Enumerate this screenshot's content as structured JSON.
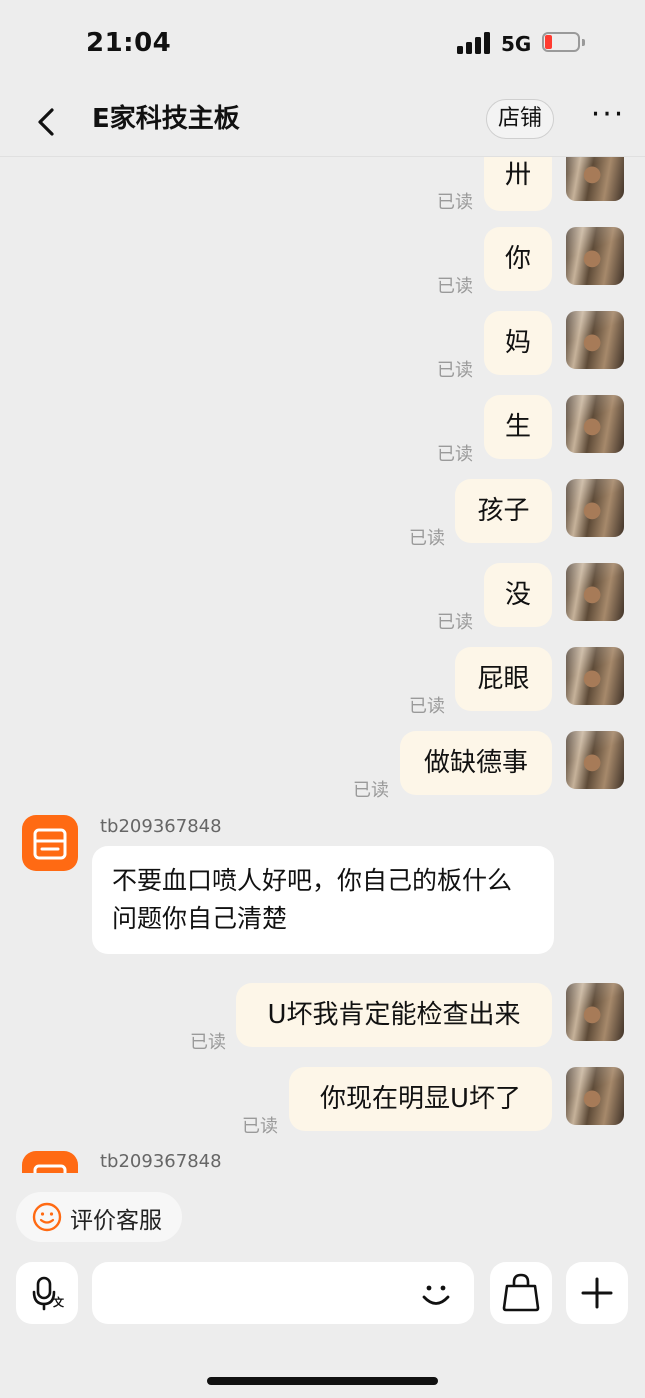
{
  "status_bar": {
    "time": "21:04",
    "network": "5G"
  },
  "nav": {
    "title": "E家科技主板",
    "shop_label": "店铺",
    "more_label": "···"
  },
  "read_label": "已读",
  "messages": [
    {
      "from": "self",
      "text": "卅"
    },
    {
      "from": "self",
      "text": "你"
    },
    {
      "from": "self",
      "text": "妈"
    },
    {
      "from": "self",
      "text": "生"
    },
    {
      "from": "self",
      "text": "孩子"
    },
    {
      "from": "self",
      "text": "没"
    },
    {
      "from": "self",
      "text": "屁眼"
    },
    {
      "from": "self",
      "text": "做缺德事"
    },
    {
      "from": "shop",
      "nick": "tb209367848",
      "text": "不要血口喷人好吧，你自己的板什么问题你自己清楚"
    },
    {
      "from": "self",
      "text": "U坏我肯定能检查出来"
    },
    {
      "from": "self",
      "text": "你现在明显U坏了"
    },
    {
      "from": "shop",
      "nick": "tb209367848",
      "text": ""
    }
  ],
  "rate_chip": {
    "label": "评价客服"
  },
  "input": {
    "placeholder": ""
  },
  "icons": {
    "back": "chevron-left-icon",
    "voice": "microphone-translate-icon",
    "emoji": "smile-icon",
    "bag": "shopping-bag-icon",
    "plus": "plus-icon"
  },
  "colors": {
    "background": "#ededed",
    "self_bubble": "#fdf6e8",
    "other_bubble": "#ffffff",
    "shop_avatar": "#ff6a13",
    "read_text": "#9a9a9a"
  }
}
